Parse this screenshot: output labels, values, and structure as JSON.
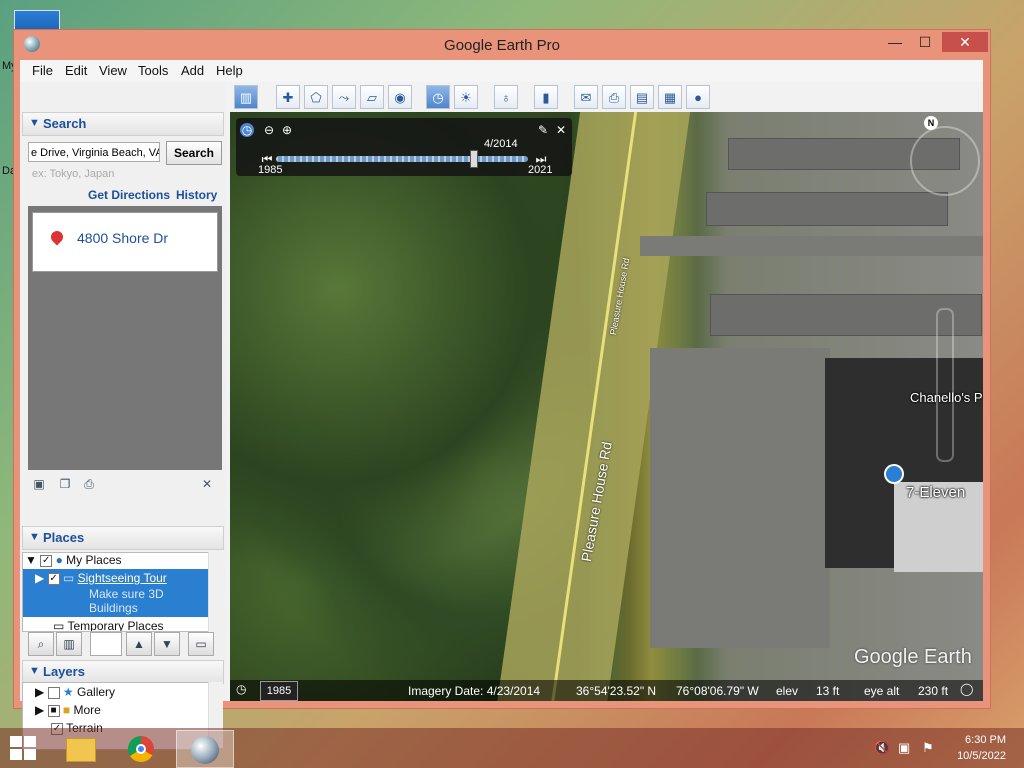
{
  "window": {
    "title": "Google Earth Pro",
    "controls": {
      "minimize": "—",
      "maximize": "☐",
      "close": "✕"
    }
  },
  "menu": [
    "File",
    "Edit",
    "View",
    "Tools",
    "Add",
    "Help"
  ],
  "search": {
    "header": "Search",
    "value": "e Drive, Virginia Beach, VA",
    "button": "Search",
    "hint": "ex: Tokyo, Japan",
    "get_directions": "Get Directions",
    "history": "History",
    "result": "4800 Shore Dr"
  },
  "places": {
    "header": "Places",
    "items": [
      {
        "label": "My Places",
        "checked": true
      },
      {
        "label": "Sightseeing Tour",
        "checked": true,
        "note": "Make sure 3D Buildings",
        "selected": true
      },
      {
        "label": "Temporary Places",
        "checked": false
      }
    ]
  },
  "layers": {
    "header": "Layers",
    "items": [
      {
        "label": "Gallery"
      },
      {
        "label": "More"
      },
      {
        "label": "Terrain",
        "checked": true
      }
    ]
  },
  "timeline": {
    "current": "4/2014",
    "start": "1985",
    "end": "2021"
  },
  "map": {
    "road_label_1": "Pleasure House Rd",
    "road_label_2": "Pleasure House Rd",
    "poi_1": "Chanello's P",
    "poi_2": "7-Eleven",
    "watermark": "Google Earth",
    "compass": "N"
  },
  "status": {
    "year": "1985",
    "imagery_date": "Imagery Date: 4/23/2014",
    "lat": "36°54'23.52\" N",
    "lon": "76°08'06.79\" W",
    "elev_label": "elev",
    "elev": "13 ft",
    "eye_alt_label": "eye alt",
    "eye_alt": "230 ft"
  },
  "taskbar": {
    "time": "6:30 PM",
    "date": "10/5/2022"
  },
  "desktop": {
    "label_a": "My",
    "label_b": "Da"
  }
}
